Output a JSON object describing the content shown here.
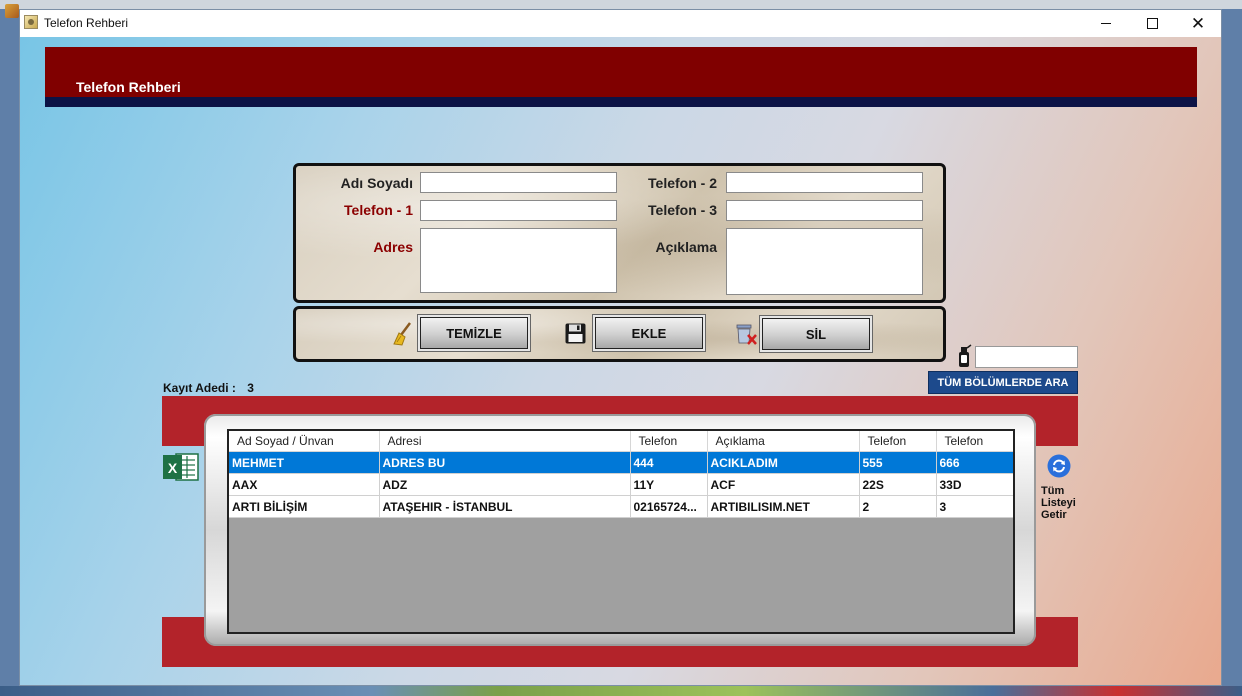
{
  "window": {
    "title": "Telefon Rehberi"
  },
  "header": {
    "title": "Telefon Rehberi"
  },
  "form": {
    "name_label": "Adı Soyadı",
    "phone1_label": "Telefon - 1",
    "address_label": "Adres",
    "phone2_label": "Telefon - 2",
    "phone3_label": "Telefon - 3",
    "note_label": "Açıklama",
    "name_value": "",
    "phone1_value": "",
    "address_value": "",
    "phone2_value": "",
    "phone3_value": "",
    "note_value": ""
  },
  "actions": {
    "clear_label": "TEMİZLE",
    "add_label": "EKLE",
    "delete_label": "SİL"
  },
  "record_count": {
    "label": "Kayıt Adedi :",
    "value": "3"
  },
  "search": {
    "value": "",
    "button_label": "TÜM BÖLÜMLERDE ARA"
  },
  "refresh": {
    "label": "Tüm Listeyi Getir"
  },
  "grid": {
    "columns": [
      "Ad Soyad / Ünvan",
      "Adresi",
      "Telefon",
      "Açıklama",
      "Telefon",
      "Telefon"
    ],
    "rows": [
      [
        "MEHMET",
        "ADRES BU",
        "444",
        "ACIKLADIM",
        "555",
        "666"
      ],
      [
        "AAX",
        "ADZ",
        "11Y",
        "ACF",
        "22S",
        "33D"
      ],
      [
        "ARTI BİLİŞİM",
        "ATAŞEHIR - İSTANBUL",
        "02165724...",
        "ARTIBILISIM.NET",
        "2",
        "3"
      ]
    ],
    "selected_row": 0
  },
  "colors": {
    "header": "#800000",
    "header_line": "#0c1346",
    "band": "#b3232a",
    "selection": "#0078d7",
    "search_button": "#1d4a8c"
  }
}
